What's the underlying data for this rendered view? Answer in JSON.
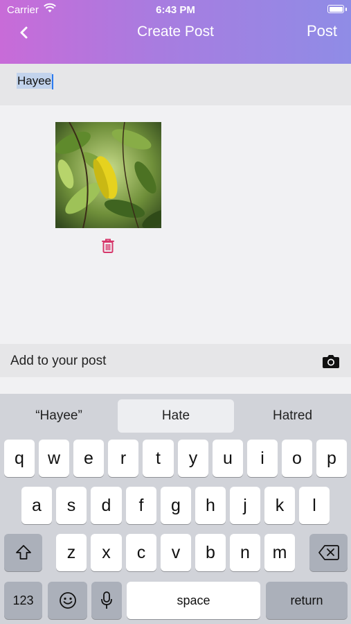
{
  "status_bar": {
    "carrier": "Carrier",
    "time": "6:43 PM"
  },
  "nav": {
    "title": "Create Post",
    "post_label": "Post"
  },
  "composer": {
    "text": "Hayee"
  },
  "add_bar": {
    "label": "Add to your post"
  },
  "keyboard": {
    "suggestions": [
      "“Hayee”",
      "Hate",
      "Hatred"
    ],
    "row1": [
      "q",
      "w",
      "e",
      "r",
      "t",
      "y",
      "u",
      "i",
      "o",
      "p"
    ],
    "row2": [
      "a",
      "s",
      "d",
      "f",
      "g",
      "h",
      "j",
      "k",
      "l"
    ],
    "row3": [
      "z",
      "x",
      "c",
      "v",
      "b",
      "n",
      "m"
    ],
    "numbers_label": "123",
    "space_label": "space",
    "return_label": "return"
  }
}
